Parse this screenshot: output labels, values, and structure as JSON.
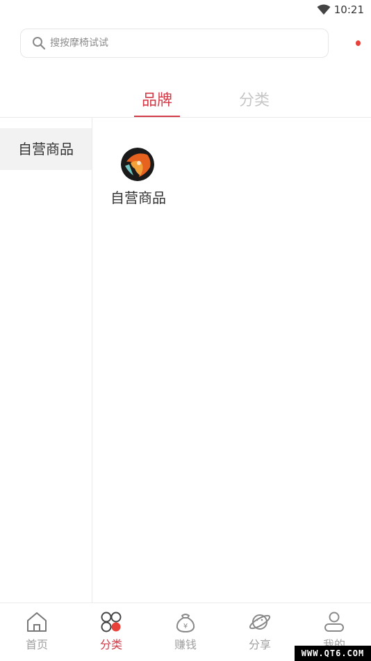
{
  "status_bar": {
    "time": "10:21",
    "wifi_icon": "wifi-icon"
  },
  "search": {
    "placeholder": "搜按摩椅试试",
    "icon": "search-icon"
  },
  "tabs": [
    {
      "label": "品牌",
      "active": true
    },
    {
      "label": "分类",
      "active": false
    }
  ],
  "sidebar": {
    "items": [
      {
        "label": "自营商品",
        "selected": true
      }
    ]
  },
  "brands": [
    {
      "name": "自营商品"
    }
  ],
  "bottom_nav": {
    "items": [
      {
        "label": "首页",
        "icon": "home-icon",
        "active": false
      },
      {
        "label": "分类",
        "icon": "category-icon",
        "active": true
      },
      {
        "label": "赚钱",
        "icon": "money-bag-icon",
        "active": false
      },
      {
        "label": "分享",
        "icon": "planet-icon",
        "active": false
      },
      {
        "label": "我的",
        "icon": "profile-icon",
        "active": false
      }
    ]
  },
  "watermark": "WWW.QT6.COM",
  "colors": {
    "accent": "#d23a47",
    "inactive": "#a0a0a0",
    "notify_dot": "#e8413a"
  }
}
